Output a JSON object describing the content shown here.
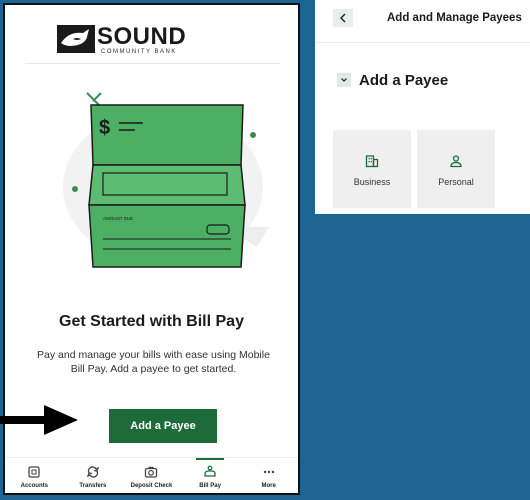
{
  "bank": {
    "name": "SOUND",
    "subtitle": "COMMUNITY BANK"
  },
  "illustration": {
    "check_symbol": "$",
    "check_field_label": "AMOUNT DUE"
  },
  "onboarding": {
    "title": "Get Started with Bill Pay",
    "description": "Pay and manage your bills with ease using Mobile Bill Pay. Add a payee to get started.",
    "cta_label": "Add a Payee"
  },
  "tabs": [
    {
      "label": "Accounts",
      "icon": "accounts-icon",
      "active": false
    },
    {
      "label": "Transfers",
      "icon": "transfers-icon",
      "active": false
    },
    {
      "label": "Deposit Check",
      "icon": "camera-icon",
      "active": false
    },
    {
      "label": "Bill Pay",
      "icon": "bill-pay-icon",
      "active": true
    },
    {
      "label": "More",
      "icon": "more-icon",
      "active": false
    }
  ],
  "payees": {
    "header": "Add and Manage Payees",
    "section_title": "Add a Payee",
    "options": [
      {
        "label": "Business",
        "icon": "building-icon"
      },
      {
        "label": "Personal",
        "icon": "person-icon"
      }
    ]
  },
  "colors": {
    "brand_green": "#1e6b3a",
    "check_green": "#4caf64",
    "background_blue": "#1e6490"
  }
}
